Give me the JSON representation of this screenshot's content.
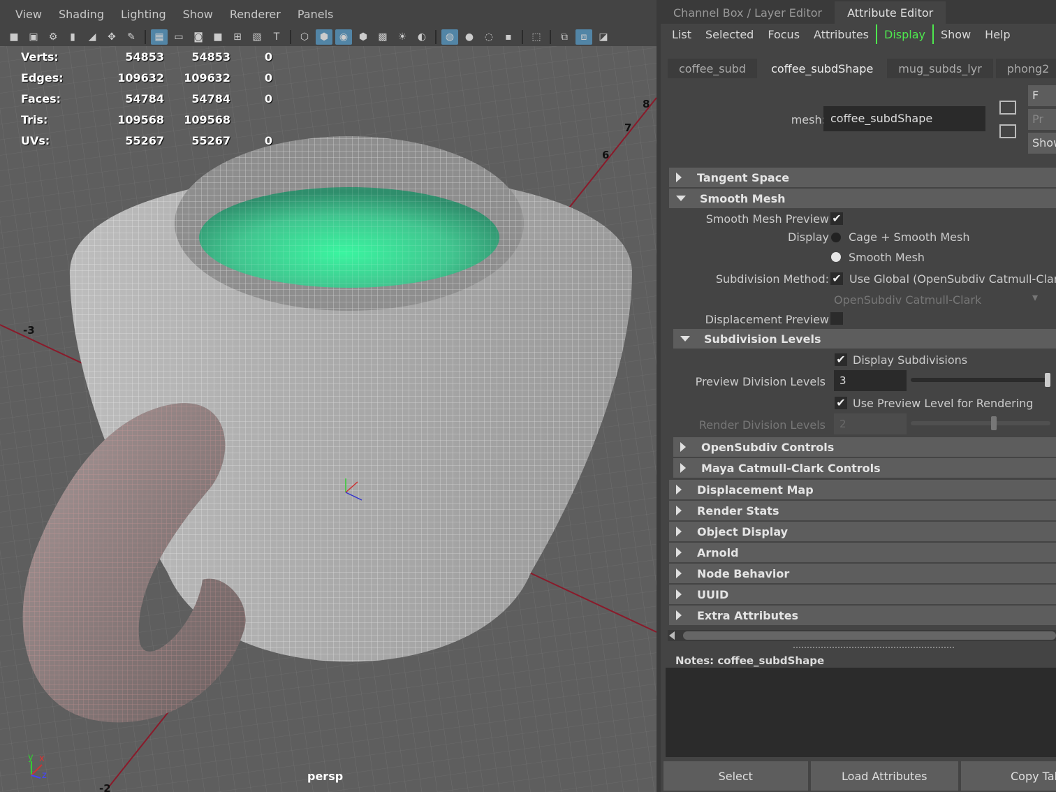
{
  "viewport": {
    "menus": [
      "View",
      "Shading",
      "Lighting",
      "Show",
      "Renderer",
      "Panels"
    ],
    "camera_label": "persp",
    "hud": [
      {
        "label": "Verts:",
        "v1": "54853",
        "v2": "54853",
        "v3": "0"
      },
      {
        "label": "Edges:",
        "v1": "109632",
        "v2": "109632",
        "v3": "0"
      },
      {
        "label": "Faces:",
        "v1": "54784",
        "v2": "54784",
        "v3": "0"
      },
      {
        "label": "Tris:",
        "v1": "109568",
        "v2": "109568",
        "v3": ""
      },
      {
        "label": "UVs:",
        "v1": "55267",
        "v2": "55267",
        "v3": "0"
      }
    ],
    "grid_numbers": {
      "n8": "8",
      "n7": "7",
      "n6": "6",
      "nm3": "-3",
      "nm2": "-2"
    },
    "axis_labels": {
      "x": "x",
      "y": "y",
      "z": "z"
    }
  },
  "panel": {
    "tabs": [
      "Channel Box / Layer Editor",
      "Attribute Editor"
    ],
    "menu": [
      "List",
      "Selected",
      "Focus",
      "Attributes",
      "Display",
      "Show",
      "Help"
    ],
    "node_tabs": [
      "coffee_subd",
      "coffee_subdShape",
      "mug_subds_lyr",
      "phong2"
    ],
    "mesh_label": "mesh:",
    "mesh_value": "coffee_subdShape",
    "side_buttons": [
      "F",
      "Pr",
      "Show"
    ],
    "sections": {
      "tangent_space": "Tangent Space",
      "smooth_mesh": "Smooth Mesh",
      "subdivision_levels": "Subdivision Levels",
      "opensubdiv_controls": "OpenSubdiv Controls",
      "maya_cc_controls": "Maya Catmull-Clark Controls",
      "displacement_map": "Displacement Map",
      "render_stats": "Render Stats",
      "object_display": "Object Display",
      "arnold": "Arnold",
      "node_behavior": "Node Behavior",
      "uuid": "UUID",
      "extra_attributes": "Extra Attributes"
    },
    "smooth_mesh": {
      "preview_label": "Smooth Mesh Preview",
      "display_label": "Display",
      "display_options": [
        "Cage + Smooth Mesh",
        "Smooth Mesh"
      ],
      "subdiv_method_label": "Subdivision Method:",
      "use_global_label": "Use Global (OpenSubdiv Catmull-Clark)",
      "method_dropdown": "OpenSubdiv Catmull-Clark",
      "displacement_preview_label": "Displacement Preview"
    },
    "subdivision_levels": {
      "display_subdivisions_label": "Display Subdivisions",
      "preview_levels_label": "Preview Division Levels",
      "preview_levels_value": "3",
      "preview_fraction": 1.0,
      "use_preview_label": "Use Preview Level for Rendering",
      "render_levels_label": "Render Division Levels",
      "render_levels_value": "2",
      "render_fraction": 0.6
    },
    "notes_label": "Notes:  coffee_subdShape",
    "bottom_buttons": [
      "Select",
      "Load Attributes",
      "Copy Tab"
    ]
  }
}
